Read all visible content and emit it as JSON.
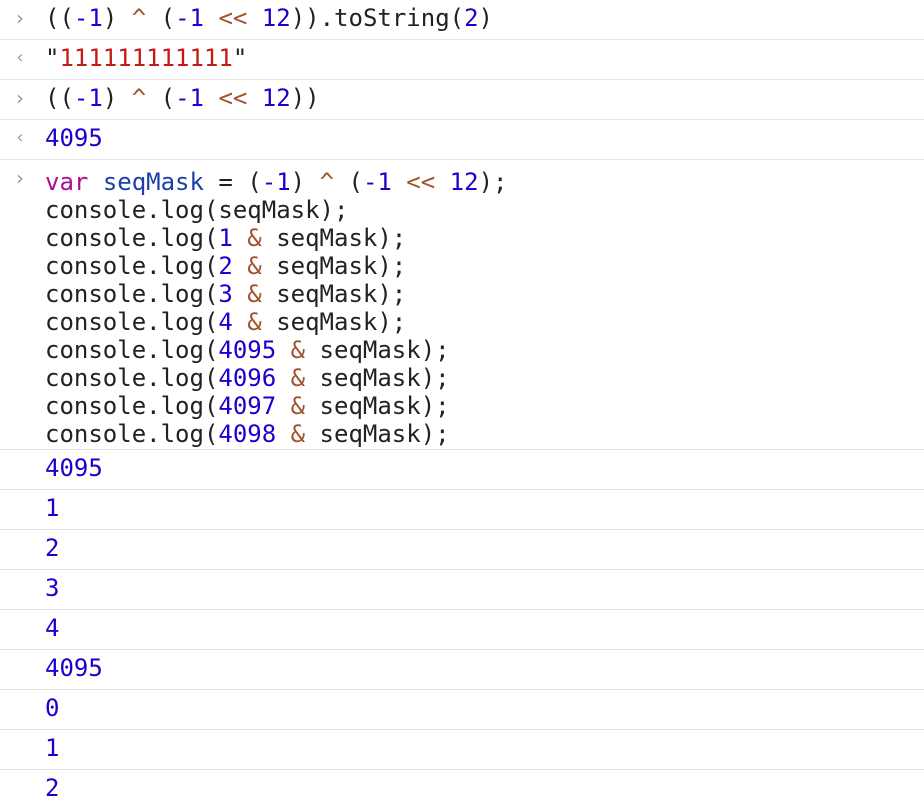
{
  "colors": {
    "number": "#1c00cf",
    "operator": "#a0522d",
    "keyword": "#aa0d91",
    "identifier": "#1d3fa8",
    "string": "#c41a16",
    "text": "#222222",
    "icon": "#9a9a9a",
    "separator": "#e3e3e3"
  },
  "icons": {
    "prompt": "›",
    "result": "‹"
  },
  "entries": [
    {
      "kind": "input",
      "tokens": [
        {
          "text": "((",
          "type": "text"
        },
        {
          "text": "-1",
          "type": "number"
        },
        {
          "text": ") ",
          "type": "text"
        },
        {
          "text": "^",
          "type": "operator"
        },
        {
          "text": " (",
          "type": "text"
        },
        {
          "text": "-1",
          "type": "number"
        },
        {
          "text": " ",
          "type": "text"
        },
        {
          "text": "<<",
          "type": "operator"
        },
        {
          "text": " ",
          "type": "text"
        },
        {
          "text": "12",
          "type": "number"
        },
        {
          "text": ")).toString(",
          "type": "text"
        },
        {
          "text": "2",
          "type": "number"
        },
        {
          "text": ")",
          "type": "text"
        }
      ]
    },
    {
      "kind": "result",
      "tokens": [
        {
          "text": "\"",
          "type": "text"
        },
        {
          "text": "111111111111",
          "type": "string"
        },
        {
          "text": "\"",
          "type": "text"
        }
      ]
    },
    {
      "kind": "input",
      "tokens": [
        {
          "text": "((",
          "type": "text"
        },
        {
          "text": "-1",
          "type": "number"
        },
        {
          "text": ") ",
          "type": "text"
        },
        {
          "text": "^",
          "type": "operator"
        },
        {
          "text": " (",
          "type": "text"
        },
        {
          "text": "-1",
          "type": "number"
        },
        {
          "text": " ",
          "type": "text"
        },
        {
          "text": "<<",
          "type": "operator"
        },
        {
          "text": " ",
          "type": "text"
        },
        {
          "text": "12",
          "type": "number"
        },
        {
          "text": "))",
          "type": "text"
        }
      ]
    },
    {
      "kind": "result",
      "tokens": [
        {
          "text": "4095",
          "type": "number"
        }
      ]
    },
    {
      "kind": "input-multi",
      "lines": [
        [
          {
            "text": "var",
            "type": "keyword"
          },
          {
            "text": " ",
            "type": "text"
          },
          {
            "text": "seqMask",
            "type": "identifier"
          },
          {
            "text": " = (",
            "type": "text"
          },
          {
            "text": "-1",
            "type": "number"
          },
          {
            "text": ") ",
            "type": "text"
          },
          {
            "text": "^",
            "type": "operator"
          },
          {
            "text": " (",
            "type": "text"
          },
          {
            "text": "-1",
            "type": "number"
          },
          {
            "text": " ",
            "type": "text"
          },
          {
            "text": "<<",
            "type": "operator"
          },
          {
            "text": " ",
            "type": "text"
          },
          {
            "text": "12",
            "type": "number"
          },
          {
            "text": ");",
            "type": "text"
          }
        ],
        [
          {
            "text": "console.log(seqMask);",
            "type": "text"
          }
        ],
        [
          {
            "text": "console.log(",
            "type": "text"
          },
          {
            "text": "1",
            "type": "number"
          },
          {
            "text": " ",
            "type": "text"
          },
          {
            "text": "&",
            "type": "operator"
          },
          {
            "text": " seqMask);",
            "type": "text"
          }
        ],
        [
          {
            "text": "console.log(",
            "type": "text"
          },
          {
            "text": "2",
            "type": "number"
          },
          {
            "text": " ",
            "type": "text"
          },
          {
            "text": "&",
            "type": "operator"
          },
          {
            "text": " seqMask);",
            "type": "text"
          }
        ],
        [
          {
            "text": "console.log(",
            "type": "text"
          },
          {
            "text": "3",
            "type": "number"
          },
          {
            "text": " ",
            "type": "text"
          },
          {
            "text": "&",
            "type": "operator"
          },
          {
            "text": " seqMask);",
            "type": "text"
          }
        ],
        [
          {
            "text": "console.log(",
            "type": "text"
          },
          {
            "text": "4",
            "type": "number"
          },
          {
            "text": " ",
            "type": "text"
          },
          {
            "text": "&",
            "type": "operator"
          },
          {
            "text": " seqMask);",
            "type": "text"
          }
        ],
        [
          {
            "text": "console.log(",
            "type": "text"
          },
          {
            "text": "4095",
            "type": "number"
          },
          {
            "text": " ",
            "type": "text"
          },
          {
            "text": "&",
            "type": "operator"
          },
          {
            "text": " seqMask);",
            "type": "text"
          }
        ],
        [
          {
            "text": "console.log(",
            "type": "text"
          },
          {
            "text": "4096",
            "type": "number"
          },
          {
            "text": " ",
            "type": "text"
          },
          {
            "text": "&",
            "type": "operator"
          },
          {
            "text": " seqMask);",
            "type": "text"
          }
        ],
        [
          {
            "text": "console.log(",
            "type": "text"
          },
          {
            "text": "4097",
            "type": "number"
          },
          {
            "text": " ",
            "type": "text"
          },
          {
            "text": "&",
            "type": "operator"
          },
          {
            "text": " seqMask);",
            "type": "text"
          }
        ],
        [
          {
            "text": "console.log(",
            "type": "text"
          },
          {
            "text": "4098",
            "type": "number"
          },
          {
            "text": " ",
            "type": "text"
          },
          {
            "text": "&",
            "type": "operator"
          },
          {
            "text": " seqMask);",
            "type": "text"
          }
        ]
      ]
    },
    {
      "kind": "log",
      "text": "4095"
    },
    {
      "kind": "log",
      "text": "1"
    },
    {
      "kind": "log",
      "text": "2"
    },
    {
      "kind": "log",
      "text": "3"
    },
    {
      "kind": "log",
      "text": "4"
    },
    {
      "kind": "log",
      "text": "4095"
    },
    {
      "kind": "log",
      "text": "0"
    },
    {
      "kind": "log",
      "text": "1"
    },
    {
      "kind": "log",
      "text": "2"
    }
  ]
}
